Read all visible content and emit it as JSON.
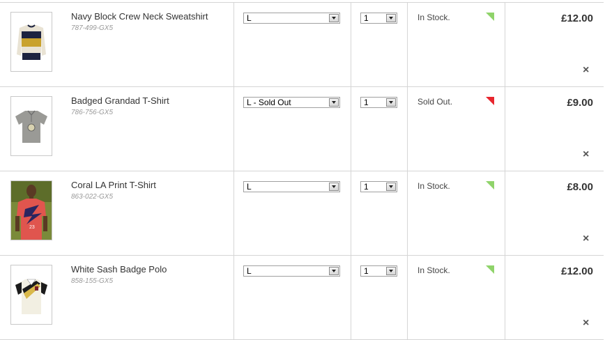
{
  "basket": {
    "items": [
      {
        "name": "Navy Block Crew Neck Sweatshirt",
        "code": "787-499-GX5",
        "size": "L",
        "qty": "1",
        "stock_label": "In Stock.",
        "stock_color": "#8fd36a",
        "price": "£12.00",
        "remove_icon": "×",
        "icon": "sweatshirt-thumbnail"
      },
      {
        "name": "Badged Grandad T-Shirt",
        "code": "786-756-GX5",
        "size": "L - Sold Out",
        "qty": "1",
        "stock_label": "Sold Out.",
        "stock_color": "#e8262e",
        "price": "£9.00",
        "remove_icon": "×",
        "icon": "tshirt-thumbnail"
      },
      {
        "name": "Coral LA Print T-Shirt",
        "code": "863-022-GX5",
        "size": "L",
        "qty": "1",
        "stock_label": "In Stock.",
        "stock_color": "#8fd36a",
        "price": "£8.00",
        "remove_icon": "×",
        "icon": "model-photo-thumbnail"
      },
      {
        "name": "White Sash Badge Polo",
        "code": "858-155-GX5",
        "size": "L",
        "qty": "1",
        "stock_label": "In Stock.",
        "stock_color": "#8fd36a",
        "price": "£12.00",
        "remove_icon": "×",
        "icon": "polo-thumbnail"
      }
    ]
  }
}
